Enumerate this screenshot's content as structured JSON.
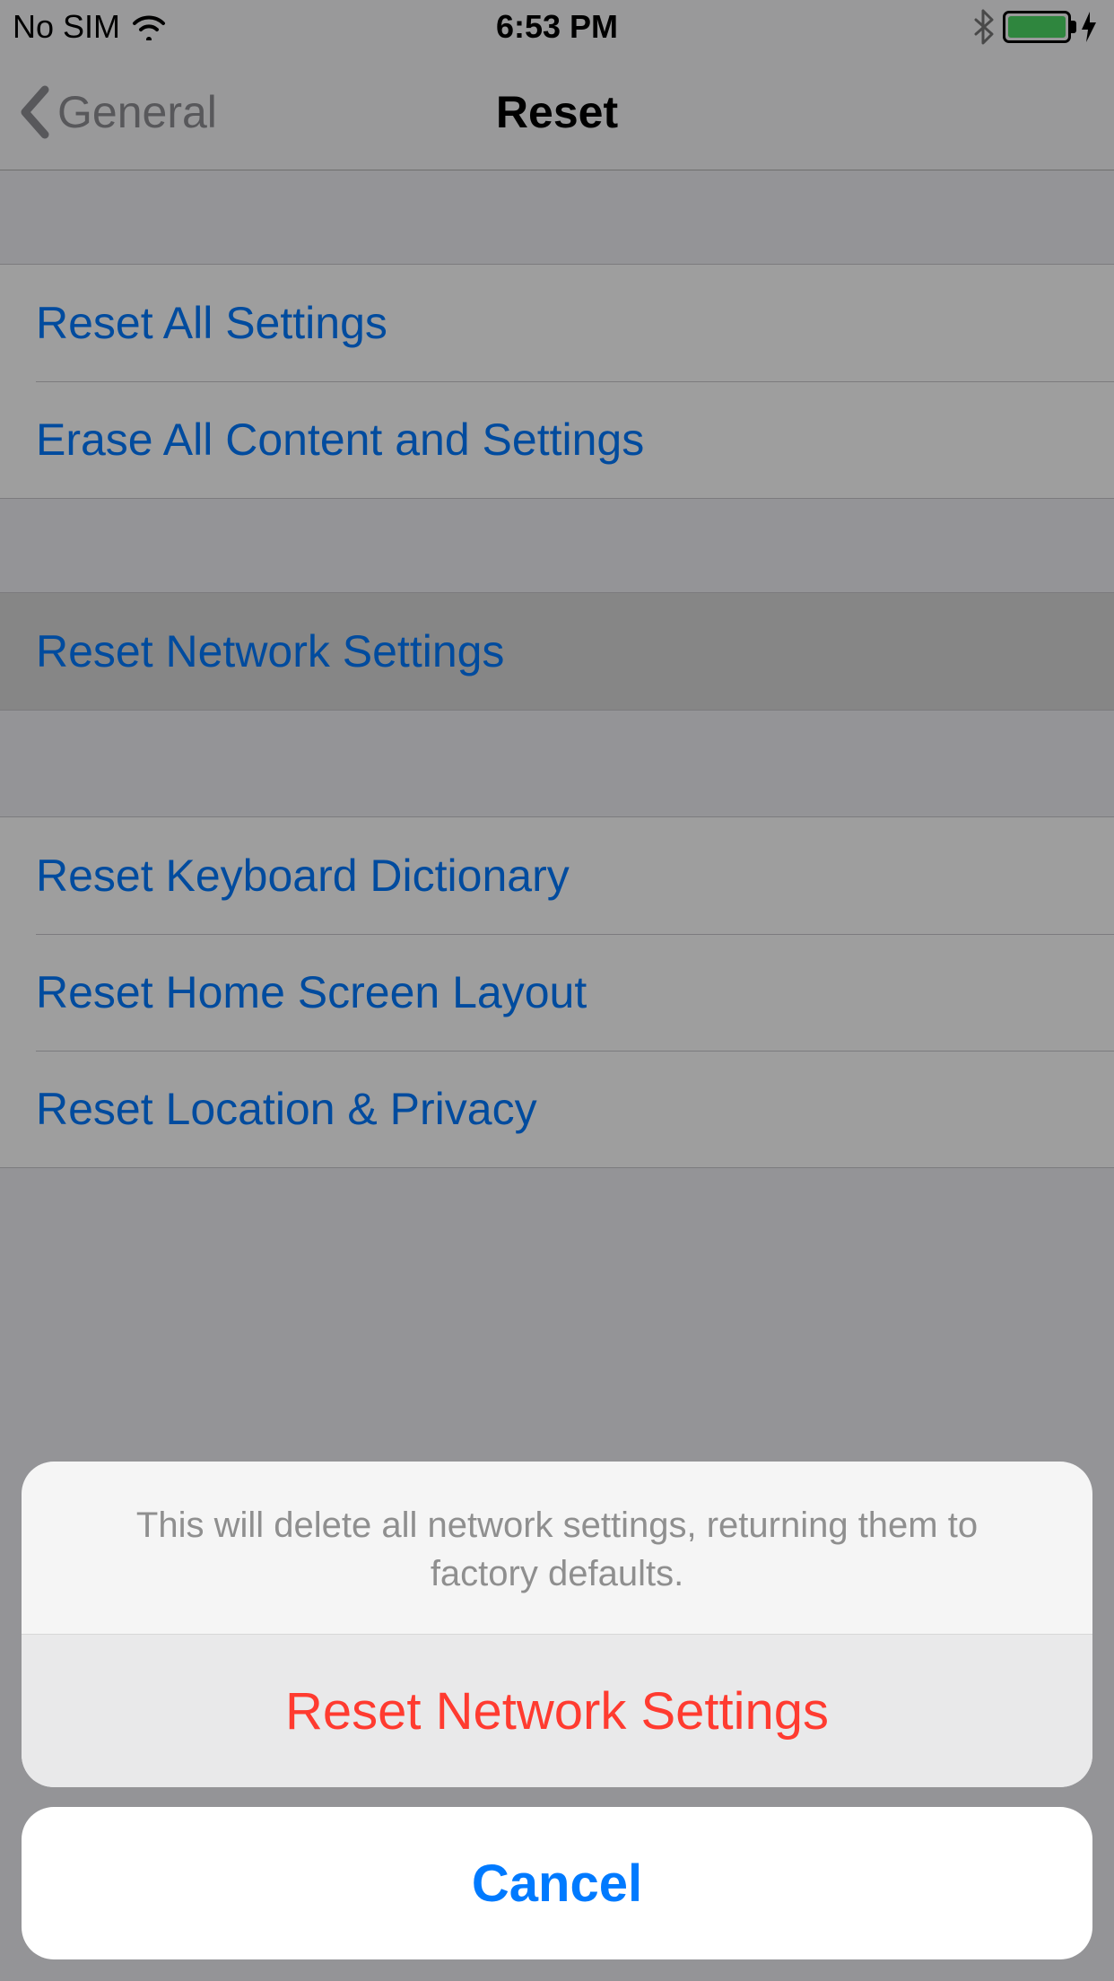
{
  "status": {
    "carrier": "No SIM",
    "time": "6:53 PM"
  },
  "nav": {
    "back": "General",
    "title": "Reset"
  },
  "groups": [
    {
      "rows": [
        {
          "label": "Reset All Settings",
          "highlight": false
        },
        {
          "label": "Erase All Content and Settings",
          "highlight": false
        }
      ]
    },
    {
      "rows": [
        {
          "label": "Reset Network Settings",
          "highlight": true
        }
      ]
    },
    {
      "rows": [
        {
          "label": "Reset Keyboard Dictionary",
          "highlight": false
        },
        {
          "label": "Reset Home Screen Layout",
          "highlight": false
        },
        {
          "label": "Reset Location & Privacy",
          "highlight": false
        }
      ]
    }
  ],
  "sheet": {
    "message": "This will delete all network settings, returning them to factory defaults.",
    "confirm": "Reset Network Settings",
    "cancel": "Cancel"
  },
  "colors": {
    "tint": "#007aff",
    "destructive": "#ff3b30",
    "battery": "#4cd964"
  }
}
